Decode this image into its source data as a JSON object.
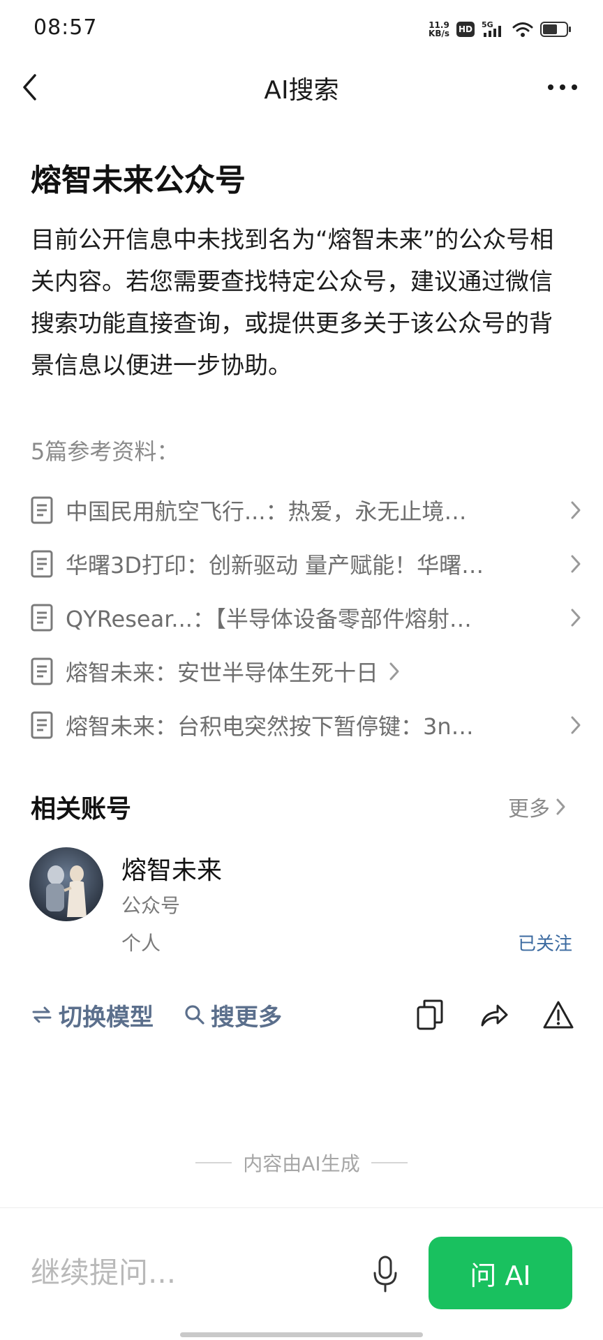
{
  "status_bar": {
    "time": "08:57",
    "net_speed_value": "11.9",
    "net_speed_unit": "KB/s",
    "hd_label": "HD",
    "network": "5G"
  },
  "header": {
    "title": "AI搜索",
    "back_icon": "chevron-left-icon",
    "more_icon": "more-horizontal-icon"
  },
  "answer": {
    "title": "熔智未来公众号",
    "body": "目前公开信息中未找到名为“熔智未来”的公众号相关内容。若您需要查找特定公众号，建议通过微信搜索功能直接查询，或提供更多关于该公众号的背景信息以便进一步协助。"
  },
  "references": {
    "heading": "5篇参考资料：",
    "items": [
      {
        "text": "中国民用航空飞行...：热爱，永无止境…"
      },
      {
        "text": "华曙3D打印：创新驱动 量产赋能！华曙…"
      },
      {
        "text": "QYResear...：【半导体设备零部件熔射…"
      },
      {
        "text": "熔智未来：安世半导体生死十日"
      },
      {
        "text": "熔智未来：台积电突然按下暂停键：3n…"
      }
    ]
  },
  "related_accounts": {
    "heading": "相关账号",
    "more_label": "更多",
    "account": {
      "name": "熔智未来",
      "type": "公众号",
      "owner": "个人",
      "follow_status": "已关注"
    }
  },
  "actions": {
    "switch_model": "切换模型",
    "search_more": "搜更多",
    "copy_icon": "copy-icon",
    "share_icon": "share-icon",
    "report_icon": "warning-icon"
  },
  "footer_note": "内容由AI生成",
  "input": {
    "placeholder": "继续提问...",
    "ask_button": "问 AI"
  },
  "colors": {
    "accent_green": "#19c15f",
    "link_blue": "#3b6aa0",
    "action_slate": "#5b6f8c"
  }
}
